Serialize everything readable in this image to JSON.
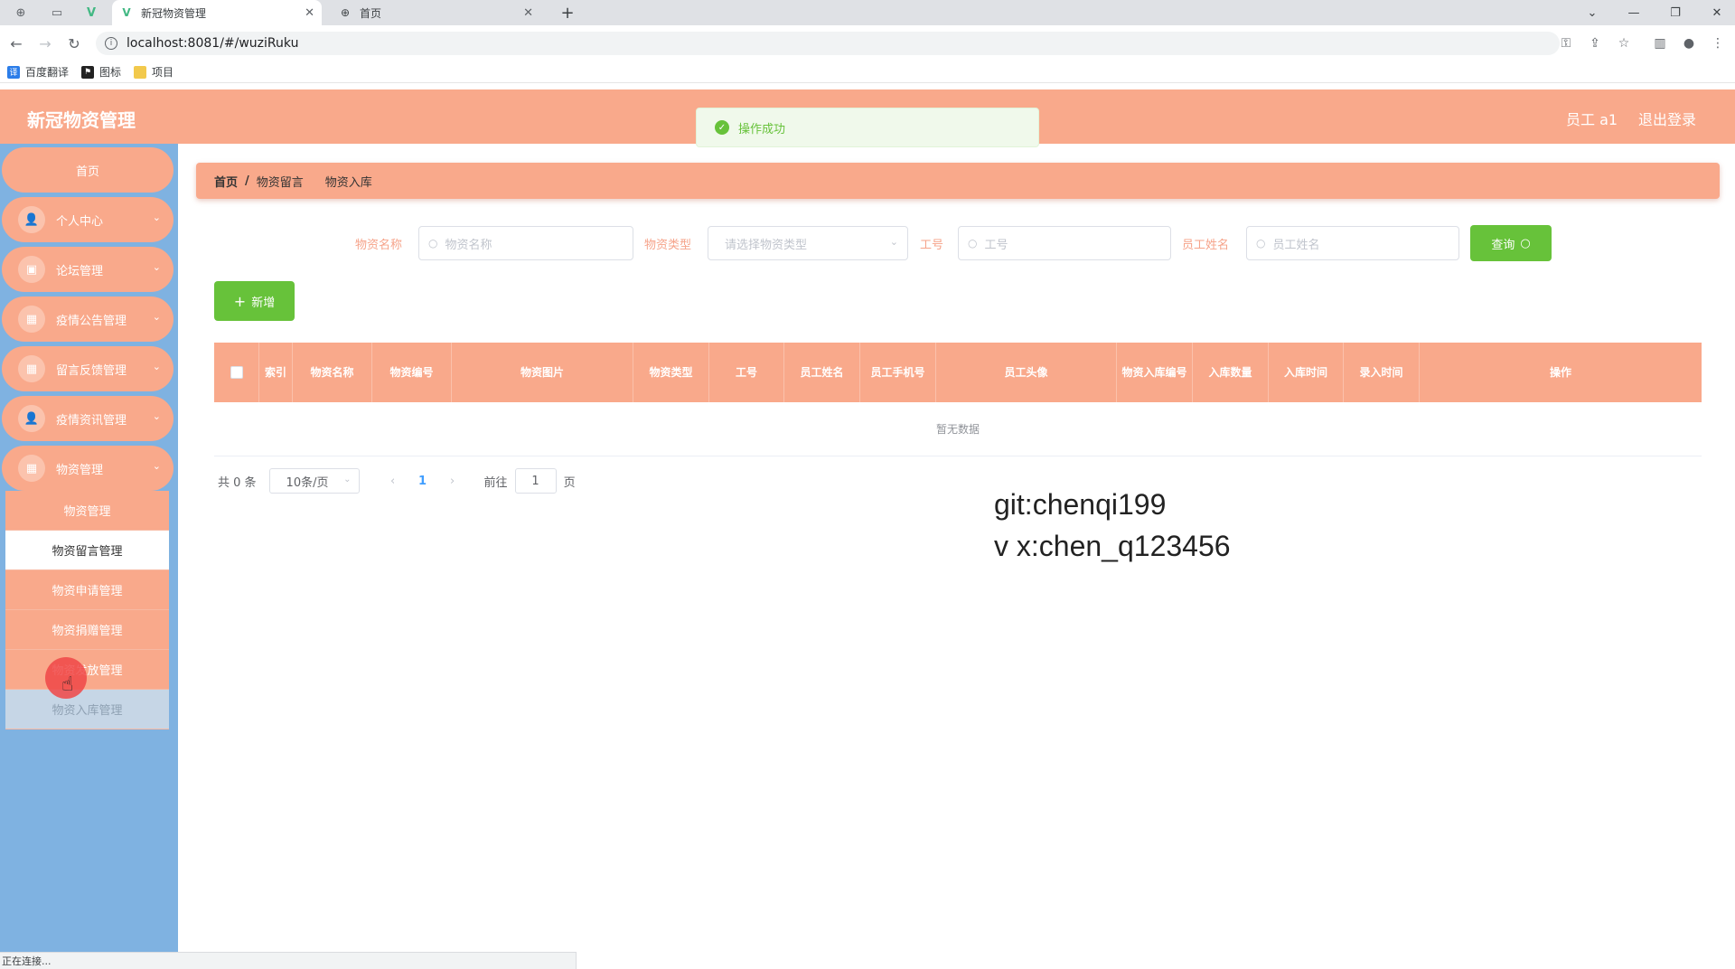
{
  "browser": {
    "tabs": [
      {
        "title": "新冠物资管理",
        "active": true
      },
      {
        "title": "首页",
        "active": false
      }
    ],
    "url": "localhost:8081/#/wuziRuku",
    "bookmarks": [
      "百度翻译",
      "图标",
      "项目"
    ],
    "status_text": "正在连接..."
  },
  "header": {
    "app_title": "新冠物资管理",
    "user": "员工 a1",
    "logout": "退出登录"
  },
  "toast": {
    "message": "操作成功"
  },
  "sidebar": {
    "home": "首页",
    "menus": [
      {
        "label": "个人中心",
        "icon": "person-icon"
      },
      {
        "label": "论坛管理",
        "icon": "briefcase-icon"
      },
      {
        "label": "疫情公告管理",
        "icon": "grid-icon"
      },
      {
        "label": "留言反馈管理",
        "icon": "grid-icon"
      },
      {
        "label": "疫情资讯管理",
        "icon": "person-icon"
      },
      {
        "label": "物资管理",
        "icon": "grid-icon"
      }
    ],
    "submenu": [
      {
        "label": "物资管理"
      },
      {
        "label": "物资留言管理",
        "active": true
      },
      {
        "label": "物资申请管理"
      },
      {
        "label": "物资捐赠管理"
      },
      {
        "label": "物资发放管理"
      },
      {
        "label": "物资入库管理"
      }
    ]
  },
  "breadcrumb": {
    "home": "首页",
    "sep": "/",
    "level1": "物资留言",
    "level2": "物资入库"
  },
  "filters": {
    "name_label": "物资名称",
    "name_placeholder": "物资名称",
    "type_label": "物资类型",
    "type_placeholder": "请选择物资类型",
    "job_label": "工号",
    "job_placeholder": "工号",
    "staff_label": "员工姓名",
    "staff_placeholder": "员工姓名",
    "query_button": "查询"
  },
  "add_button": "新增",
  "table": {
    "columns": [
      "索引",
      "物资名称",
      "物资编号",
      "物资图片",
      "物资类型",
      "工号",
      "员工姓名",
      "员工手机号",
      "员工头像",
      "物资入库编号",
      "入库数量",
      "入库时间",
      "录入时间",
      "操作"
    ],
    "empty_text": "暂无数据"
  },
  "pagination": {
    "total": "共 0 条",
    "page_size": "10条/页",
    "current_page": "1",
    "goto_label": "前往",
    "goto_value": "1",
    "page_unit": "页"
  },
  "watermark": {
    "line1": "git:chenqi199",
    "line2": "v x:chen_q123456"
  },
  "colors": {
    "accent": "#f9a98b",
    "sidebar": "#7fb2e1",
    "success": "#67c23a"
  }
}
